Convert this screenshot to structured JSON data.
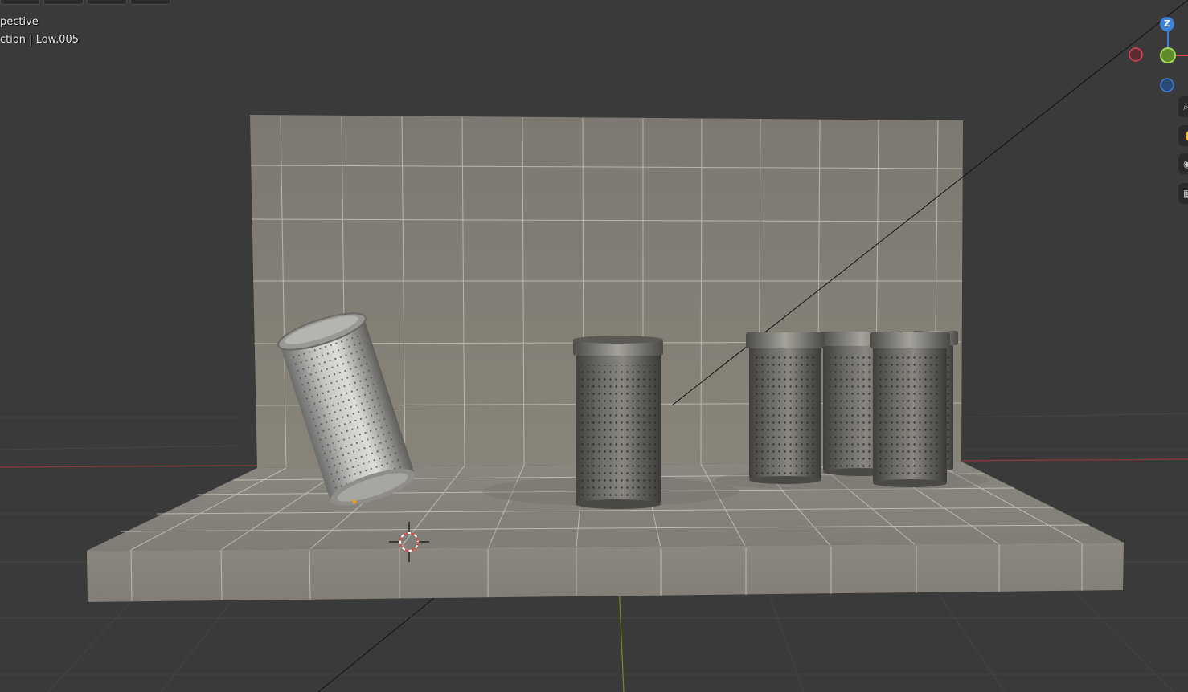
{
  "viewport": {
    "view_mode_label": "pective",
    "collection_object_label": "ction | Low.005"
  },
  "gizmo": {
    "z_label": "Z",
    "colors": {
      "x_axis": "#e0424f",
      "y_axis": "#8cc63f",
      "z_axis": "#3b82d6"
    }
  },
  "navigation_tools": [
    {
      "name": "zoom-icon",
      "glyph": "⌕"
    },
    {
      "name": "hand-icon",
      "glyph": "✋"
    },
    {
      "name": "camera-icon",
      "glyph": "◉"
    },
    {
      "name": "grid-icon",
      "glyph": "▦"
    }
  ],
  "scene": {
    "objects": [
      "wall-backdrop",
      "floor-platform",
      "trash-can-tilted",
      "trash-can-center",
      "trash-can-right-1",
      "trash-can-right-2",
      "trash-can-right-3"
    ]
  }
}
